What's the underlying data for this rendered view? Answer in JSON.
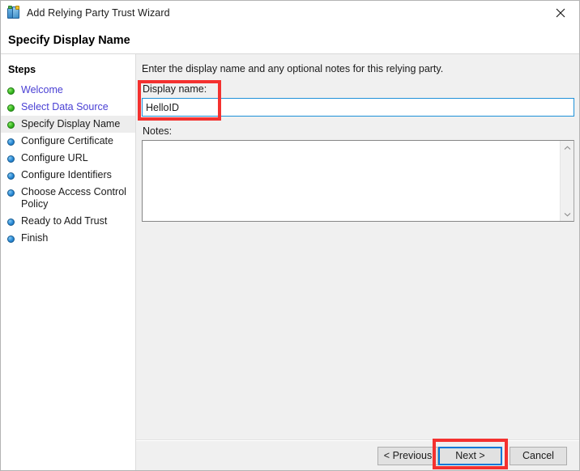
{
  "window": {
    "title": "Add Relying Party Trust Wizard",
    "icon": "wizard-app-icon",
    "close_icon": "close-icon"
  },
  "header": {
    "title": "Specify Display Name"
  },
  "sidebar": {
    "title": "Steps",
    "items": [
      {
        "label": "Welcome",
        "state": "done",
        "link": true,
        "current": false
      },
      {
        "label": "Select Data Source",
        "state": "done",
        "link": true,
        "current": false
      },
      {
        "label": "Specify Display Name",
        "state": "done",
        "link": false,
        "current": true
      },
      {
        "label": "Configure Certificate",
        "state": "todo",
        "link": false,
        "current": false
      },
      {
        "label": "Configure URL",
        "state": "todo",
        "link": false,
        "current": false
      },
      {
        "label": "Configure Identifiers",
        "state": "todo",
        "link": false,
        "current": false
      },
      {
        "label": "Choose Access Control Policy",
        "state": "todo",
        "link": false,
        "current": false
      },
      {
        "label": "Ready to Add Trust",
        "state": "todo",
        "link": false,
        "current": false
      },
      {
        "label": "Finish",
        "state": "todo",
        "link": false,
        "current": false
      }
    ]
  },
  "main": {
    "instruction": "Enter the display name and any optional notes for this relying party.",
    "display_name": {
      "label": "Display name:",
      "value": "HelloID",
      "placeholder": ""
    },
    "notes": {
      "label": "Notes:",
      "value": "",
      "placeholder": "",
      "scroll_up_icon": "chevron-up-icon",
      "scroll_down_icon": "chevron-down-icon"
    }
  },
  "footer": {
    "previous_label": "< Previous",
    "next_label": "Next >",
    "cancel_label": "Cancel"
  },
  "annotations": {
    "display_name_highlight": "red-box-display-name",
    "next_highlight": "red-box-next-button"
  },
  "colors": {
    "accent_focus": "#0078d7",
    "annotation_red": "#f4312f",
    "step_done": "#36b820",
    "step_todo": "#2a8ad6",
    "link_text": "#4a40d4"
  }
}
